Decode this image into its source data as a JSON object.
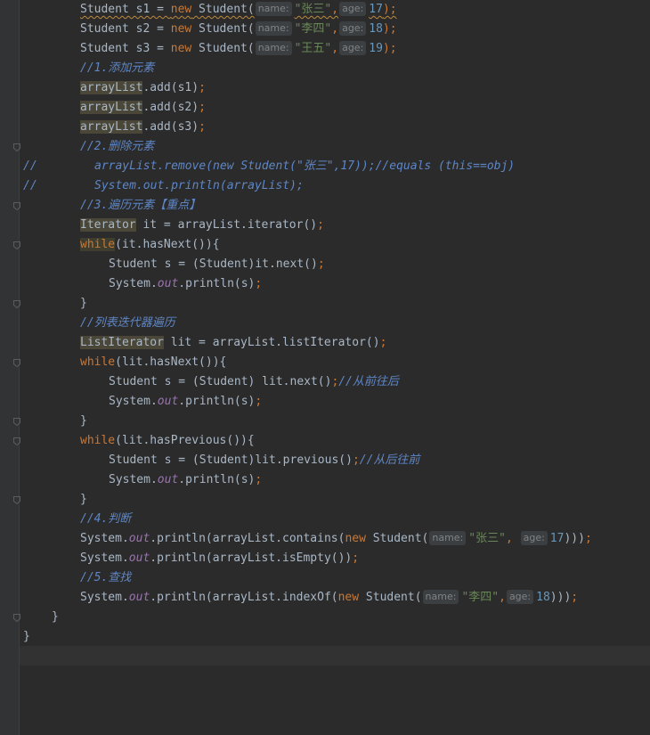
{
  "editor": {
    "lines": [
      {
        "indent": 90,
        "tokens": [
          {
            "t": "Student s1 = ",
            "c": "pl",
            "squig": true
          },
          {
            "t": "new",
            "c": "kw",
            "squig": true
          },
          {
            "t": " Student(",
            "c": "pl",
            "squig": true
          },
          {
            "t": "name:",
            "c": "hint"
          },
          {
            "t": "\"张三\"",
            "c": "str",
            "squig": true
          },
          {
            "t": ",",
            "c": "kw",
            "squig": true
          },
          {
            "t": "age:",
            "c": "hint"
          },
          {
            "t": "17",
            "c": "num",
            "squig": true
          },
          {
            "t": ");",
            "c": "kw",
            "squig": true
          }
        ]
      },
      {
        "indent": 90,
        "tokens": [
          {
            "t": "Student s2 = ",
            "c": "pl"
          },
          {
            "t": "new",
            "c": "kw"
          },
          {
            "t": " Student(",
            "c": "pl"
          },
          {
            "t": "name:",
            "c": "hint"
          },
          {
            "t": "\"李四\"",
            "c": "str"
          },
          {
            "t": ",",
            "c": "kw"
          },
          {
            "t": "age:",
            "c": "hint"
          },
          {
            "t": "18",
            "c": "num"
          },
          {
            "t": ");",
            "c": "kw"
          }
        ]
      },
      {
        "indent": 90,
        "tokens": [
          {
            "t": "Student s3 = ",
            "c": "pl"
          },
          {
            "t": "new",
            "c": "kw"
          },
          {
            "t": " Student(",
            "c": "pl"
          },
          {
            "t": "name:",
            "c": "hint"
          },
          {
            "t": "\"王五\"",
            "c": "str"
          },
          {
            "t": ",",
            "c": "kw"
          },
          {
            "t": "age:",
            "c": "hint"
          },
          {
            "t": "19",
            "c": "num"
          },
          {
            "t": ");",
            "c": "kw"
          }
        ]
      },
      {
        "indent": 90,
        "tokens": [
          {
            "t": "//1.添加元素",
            "c": "blue-cm"
          }
        ]
      },
      {
        "indent": 90,
        "tokens": [
          {
            "t": "arrayList",
            "c": "pl",
            "hl": true
          },
          {
            "t": ".add(s1)",
            "c": "pl"
          },
          {
            "t": ";",
            "c": "kw"
          }
        ]
      },
      {
        "indent": 90,
        "tokens": [
          {
            "t": "arrayList",
            "c": "pl",
            "hl": true
          },
          {
            "t": ".add(s2)",
            "c": "pl"
          },
          {
            "t": ";",
            "c": "kw"
          }
        ]
      },
      {
        "indent": 90,
        "tokens": [
          {
            "t": "arrayList",
            "c": "pl",
            "hl": true
          },
          {
            "t": ".add(s3)",
            "c": "pl"
          },
          {
            "t": ";",
            "c": "kw"
          }
        ]
      },
      {
        "indent": 90,
        "fold": true,
        "tokens": [
          {
            "t": "//2.删除元素",
            "c": "blue-cm"
          }
        ]
      },
      {
        "indent": 106,
        "marker": "//",
        "tokens": [
          {
            "t": "arrayList.remove(new Student(\"张三\",17));//equals (this==obj)",
            "c": "blue-cm"
          }
        ]
      },
      {
        "indent": 106,
        "marker": "//",
        "tokens": [
          {
            "t": "System.out.println(arrayList);",
            "c": "blue-cm"
          }
        ]
      },
      {
        "indent": 90,
        "fold": true,
        "tokens": [
          {
            "t": "//3.遍历元素【重点】",
            "c": "blue-cm"
          }
        ]
      },
      {
        "indent": 90,
        "tokens": [
          {
            "t": "Iterator",
            "c": "pl",
            "hl": true
          },
          {
            "t": " it = arrayList.iterator()",
            "c": "pl"
          },
          {
            "t": ";",
            "c": "kw"
          }
        ]
      },
      {
        "indent": 90,
        "fold": true,
        "tokens": [
          {
            "t": "while",
            "c": "kw",
            "hl2": true
          },
          {
            "t": "(it.hasNext()){",
            "c": "pl"
          }
        ]
      },
      {
        "indent": 122,
        "tokens": [
          {
            "t": "Student s = (Student)it.next()",
            "c": "pl"
          },
          {
            "t": ";",
            "c": "kw"
          }
        ]
      },
      {
        "indent": 122,
        "tokens": [
          {
            "t": "System.",
            "c": "pl"
          },
          {
            "t": "out",
            "c": "field"
          },
          {
            "t": ".println(s)",
            "c": "pl"
          },
          {
            "t": ";",
            "c": "kw"
          }
        ]
      },
      {
        "indent": 90,
        "fold": true,
        "tokens": [
          {
            "t": "}",
            "c": "pl"
          }
        ]
      },
      {
        "indent": 90,
        "tokens": [
          {
            "t": "//列表迭代器遍历",
            "c": "blue-cm"
          }
        ]
      },
      {
        "indent": 90,
        "tokens": [
          {
            "t": "ListIterator",
            "c": "pl",
            "hl": true
          },
          {
            "t": " lit = arrayList.listIterator()",
            "c": "pl"
          },
          {
            "t": ";",
            "c": "kw"
          }
        ]
      },
      {
        "indent": 90,
        "fold": true,
        "tokens": [
          {
            "t": "while",
            "c": "kw"
          },
          {
            "t": "(lit.hasNext()){",
            "c": "pl"
          }
        ]
      },
      {
        "indent": 122,
        "tokens": [
          {
            "t": "Student s = (Student) lit.next()",
            "c": "pl"
          },
          {
            "t": ";",
            "c": "kw"
          },
          {
            "t": "//从前往后",
            "c": "blue-cm"
          }
        ]
      },
      {
        "indent": 122,
        "tokens": [
          {
            "t": "System.",
            "c": "pl"
          },
          {
            "t": "out",
            "c": "field"
          },
          {
            "t": ".println(s)",
            "c": "pl"
          },
          {
            "t": ";",
            "c": "kw"
          }
        ]
      },
      {
        "indent": 90,
        "fold": true,
        "tokens": [
          {
            "t": "}",
            "c": "pl"
          }
        ]
      },
      {
        "indent": 90,
        "fold": true,
        "tokens": [
          {
            "t": "while",
            "c": "kw"
          },
          {
            "t": "(lit.hasPrevious()){",
            "c": "pl"
          }
        ]
      },
      {
        "indent": 122,
        "tokens": [
          {
            "t": "Student s = (Student)lit.previous()",
            "c": "pl"
          },
          {
            "t": ";",
            "c": "kw"
          },
          {
            "t": "//从后往前",
            "c": "blue-cm"
          }
        ]
      },
      {
        "indent": 122,
        "tokens": [
          {
            "t": "System.",
            "c": "pl"
          },
          {
            "t": "out",
            "c": "field"
          },
          {
            "t": ".println(s)",
            "c": "pl"
          },
          {
            "t": ";",
            "c": "kw"
          }
        ]
      },
      {
        "indent": 90,
        "fold": true,
        "tokens": [
          {
            "t": "}",
            "c": "pl"
          }
        ]
      },
      {
        "indent": 90,
        "tokens": [
          {
            "t": "//4.判断",
            "c": "blue-cm"
          }
        ]
      },
      {
        "indent": 90,
        "tokens": [
          {
            "t": "System.",
            "c": "pl"
          },
          {
            "t": "out",
            "c": "field"
          },
          {
            "t": ".println(arrayList.contains(",
            "c": "pl"
          },
          {
            "t": "new",
            "c": "kw"
          },
          {
            "t": " Student(",
            "c": "pl"
          },
          {
            "t": "name:",
            "c": "hint"
          },
          {
            "t": "\"张三\"",
            "c": "str"
          },
          {
            "t": ", ",
            "c": "kw"
          },
          {
            "t": "age:",
            "c": "hint"
          },
          {
            "t": "17",
            "c": "num"
          },
          {
            "t": ")))",
            "c": "pl"
          },
          {
            "t": ";",
            "c": "kw"
          }
        ]
      },
      {
        "indent": 90,
        "tokens": [
          {
            "t": "System.",
            "c": "pl"
          },
          {
            "t": "out",
            "c": "field"
          },
          {
            "t": ".println(arrayList.isEmpty())",
            "c": "pl"
          },
          {
            "t": ";",
            "c": "kw"
          }
        ]
      },
      {
        "indent": 90,
        "tokens": [
          {
            "t": "//5.查找",
            "c": "blue-cm"
          }
        ]
      },
      {
        "indent": 90,
        "tokens": [
          {
            "t": "System.",
            "c": "pl"
          },
          {
            "t": "out",
            "c": "field"
          },
          {
            "t": ".println(arrayList.indexOf(",
            "c": "pl"
          },
          {
            "t": "new",
            "c": "kw"
          },
          {
            "t": " Student(",
            "c": "pl"
          },
          {
            "t": "name:",
            "c": "hint"
          },
          {
            "t": "\"李四\"",
            "c": "str"
          },
          {
            "t": ",",
            "c": "kw"
          },
          {
            "t": "age:",
            "c": "hint"
          },
          {
            "t": "18",
            "c": "num"
          },
          {
            "t": ")))",
            "c": "pl"
          },
          {
            "t": ";",
            "c": "kw"
          }
        ]
      },
      {
        "indent": 58,
        "fold": true,
        "tokens": [
          {
            "t": "}",
            "c": "pl"
          }
        ]
      },
      {
        "indent": 26,
        "tokens": [
          {
            "t": "}",
            "c": "pl"
          }
        ]
      }
    ]
  }
}
